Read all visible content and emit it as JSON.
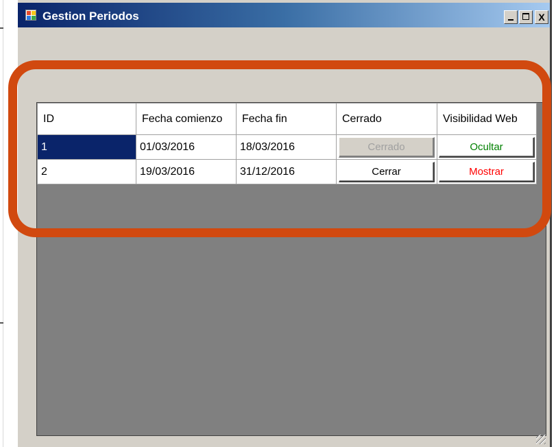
{
  "window": {
    "title": "Gestion Periodos",
    "controls": {
      "minimize": "_",
      "maximize": "□",
      "close": "X"
    }
  },
  "grid": {
    "columns": [
      "ID",
      "Fecha comienzo",
      "Fecha fin",
      "Cerrado",
      "Visibilidad Web"
    ],
    "rows": [
      {
        "id": "1",
        "start": "01/03/2016",
        "end": "18/03/2016",
        "closed_label": "Cerrado",
        "closed_enabled": false,
        "visibility_label": "Ocultar",
        "visibility_color": "#008000",
        "selected": true
      },
      {
        "id": "2",
        "start": "19/03/2016",
        "end": "31/12/2016",
        "closed_label": "Cerrar",
        "closed_enabled": true,
        "visibility_label": "Mostrar",
        "visibility_color": "#ff0000",
        "selected": false
      }
    ]
  },
  "colors": {
    "titlebar_start": "#0a246a",
    "selection": "#0a246a",
    "highlight_ring": "#d1490f",
    "window_bg": "#d4d0c8",
    "grid_bg": "#808080"
  }
}
